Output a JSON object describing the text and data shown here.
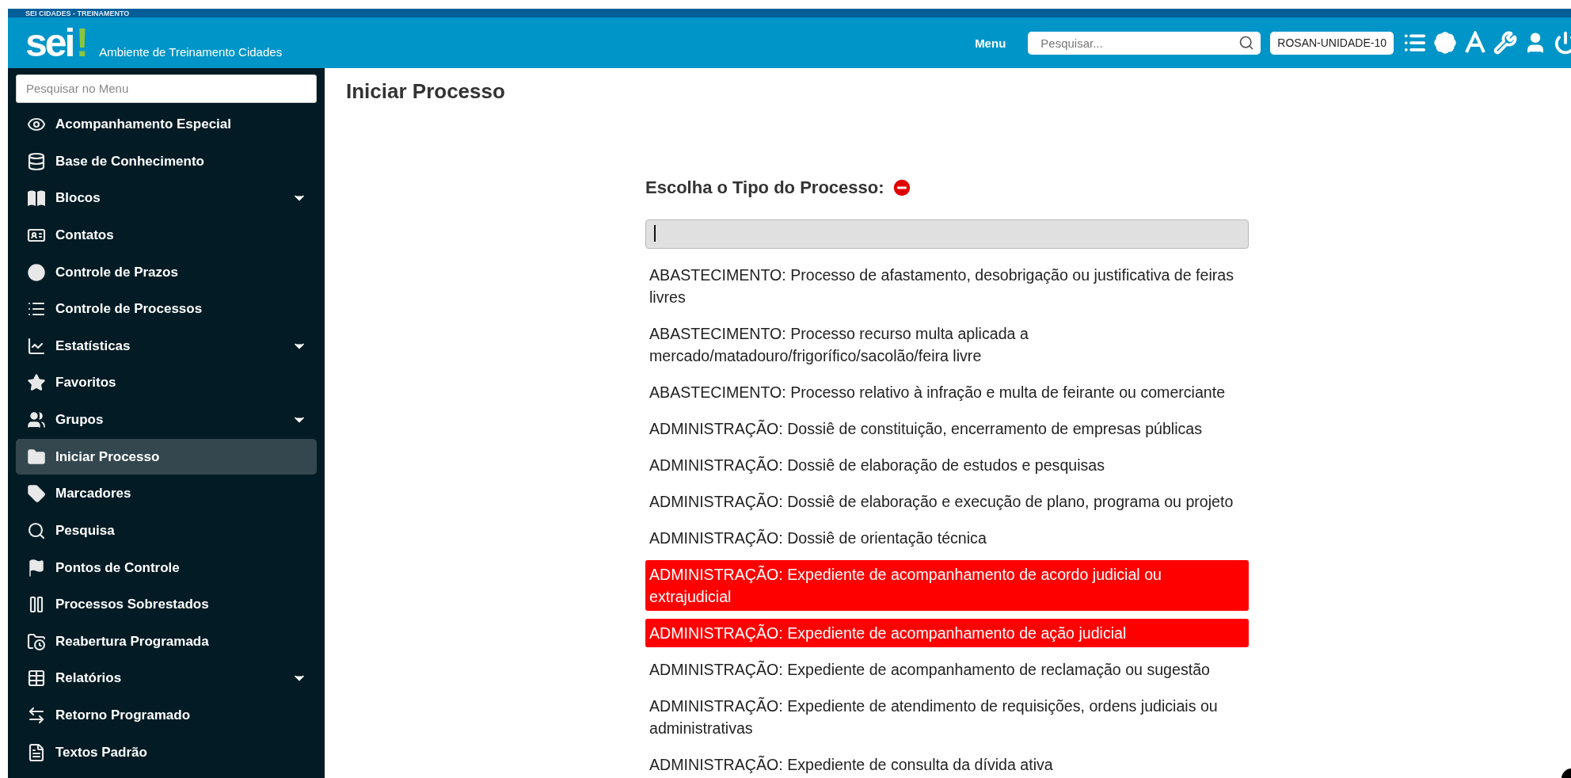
{
  "top_bar": {
    "text": "SEI CIDADES - TREINAMENTO"
  },
  "header": {
    "logo": {
      "text": "sei",
      "mark": "!"
    },
    "subtitle": "Ambiente de Treinamento Cidades",
    "menu_label": "Menu",
    "search": {
      "placeholder": "Pesquisar..."
    },
    "unit": "ROSAN-UNIDADE-10"
  },
  "sidebar": {
    "search": {
      "placeholder": "Pesquisar no Menu"
    },
    "items": [
      {
        "label": "Acompanhamento Especial",
        "selected": false,
        "has_submenu": false
      },
      {
        "label": "Base de Conhecimento",
        "selected": false,
        "has_submenu": false
      },
      {
        "label": "Blocos",
        "selected": false,
        "has_submenu": true
      },
      {
        "label": "Contatos",
        "selected": false,
        "has_submenu": false
      },
      {
        "label": "Controle de Prazos",
        "selected": false,
        "has_submenu": false
      },
      {
        "label": "Controle de Processos",
        "selected": false,
        "has_submenu": false
      },
      {
        "label": "Estatísticas",
        "selected": false,
        "has_submenu": true
      },
      {
        "label": "Favoritos",
        "selected": false,
        "has_submenu": false
      },
      {
        "label": "Grupos",
        "selected": false,
        "has_submenu": true
      },
      {
        "label": "Iniciar Processo",
        "selected": true,
        "has_submenu": false
      },
      {
        "label": "Marcadores",
        "selected": false,
        "has_submenu": false
      },
      {
        "label": "Pesquisa",
        "selected": false,
        "has_submenu": false
      },
      {
        "label": "Pontos de Controle",
        "selected": false,
        "has_submenu": false
      },
      {
        "label": "Processos Sobrestados",
        "selected": false,
        "has_submenu": false
      },
      {
        "label": "Reabertura Programada",
        "selected": false,
        "has_submenu": false
      },
      {
        "label": "Relatórios",
        "selected": false,
        "has_submenu": true
      },
      {
        "label": "Retorno Programado",
        "selected": false,
        "has_submenu": false
      },
      {
        "label": "Textos Padrão",
        "selected": false,
        "has_submenu": false
      }
    ]
  },
  "page": {
    "title": "Iniciar Processo",
    "prompt": "Escolha o Tipo do Processo:",
    "process_types": [
      {
        "label": "ABASTECIMENTO: Processo de afastamento, desobrigação ou justificativa de feiras livres",
        "selected": false
      },
      {
        "label": "ABASTECIMENTO: Processo recurso multa aplicada a mercado/matadouro/frigorífico/sacolão/feira livre",
        "selected": false
      },
      {
        "label": "ABASTECIMENTO: Processo relativo à infração e multa de feirante ou comerciante",
        "selected": false
      },
      {
        "label": "ADMINISTRAÇÃO: Dossiê de constituição, encerramento de empresas públicas",
        "selected": false
      },
      {
        "label": "ADMINISTRAÇÃO: Dossiê de elaboração de estudos e pesquisas",
        "selected": false
      },
      {
        "label": "ADMINISTRAÇÃO: Dossiê de elaboração e execução de plano, programa ou projeto",
        "selected": false
      },
      {
        "label": "ADMINISTRAÇÃO: Dossiê de orientação técnica",
        "selected": false
      },
      {
        "label": "ADMINISTRAÇÃO: Expediente de acompanhamento de acordo judicial ou extrajudicial",
        "selected": true
      },
      {
        "label": "ADMINISTRAÇÃO: Expediente de acompanhamento de ação judicial",
        "selected": true
      },
      {
        "label": "ADMINISTRAÇÃO: Expediente de acompanhamento de reclamação ou sugestão",
        "selected": false
      },
      {
        "label": "ADMINISTRAÇÃO: Expediente de atendimento de requisições, ordens judiciais ou administrativas",
        "selected": false
      },
      {
        "label": "ADMINISTRAÇÃO: Expediente de consulta da dívida ativa",
        "selected": false
      }
    ]
  }
}
